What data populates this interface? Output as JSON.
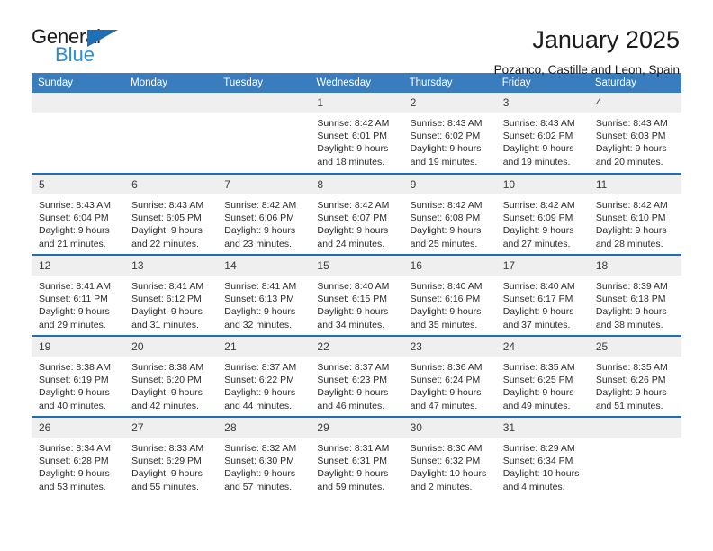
{
  "logo": {
    "word_top": "General",
    "word_bottom": "Blue",
    "triangle_color": "#1f6fb5",
    "blue_color": "#2a8fd8"
  },
  "header": {
    "title": "January 2025",
    "subtitle": "Pozanco, Castille and Leon, Spain",
    "header_bg": "#3a7dbf",
    "row_divider": "#1f6fb5",
    "daynum_bg": "#efefef"
  },
  "weekdays": [
    "Sunday",
    "Monday",
    "Tuesday",
    "Wednesday",
    "Thursday",
    "Friday",
    "Saturday"
  ],
  "weeks": [
    [
      {
        "day": "",
        "lines": []
      },
      {
        "day": "",
        "lines": []
      },
      {
        "day": "",
        "lines": []
      },
      {
        "day": "1",
        "lines": [
          "Sunrise: 8:42 AM",
          "Sunset: 6:01 PM",
          "Daylight: 9 hours",
          "and 18 minutes."
        ]
      },
      {
        "day": "2",
        "lines": [
          "Sunrise: 8:43 AM",
          "Sunset: 6:02 PM",
          "Daylight: 9 hours",
          "and 19 minutes."
        ]
      },
      {
        "day": "3",
        "lines": [
          "Sunrise: 8:43 AM",
          "Sunset: 6:02 PM",
          "Daylight: 9 hours",
          "and 19 minutes."
        ]
      },
      {
        "day": "4",
        "lines": [
          "Sunrise: 8:43 AM",
          "Sunset: 6:03 PM",
          "Daylight: 9 hours",
          "and 20 minutes."
        ]
      }
    ],
    [
      {
        "day": "5",
        "lines": [
          "Sunrise: 8:43 AM",
          "Sunset: 6:04 PM",
          "Daylight: 9 hours",
          "and 21 minutes."
        ]
      },
      {
        "day": "6",
        "lines": [
          "Sunrise: 8:43 AM",
          "Sunset: 6:05 PM",
          "Daylight: 9 hours",
          "and 22 minutes."
        ]
      },
      {
        "day": "7",
        "lines": [
          "Sunrise: 8:42 AM",
          "Sunset: 6:06 PM",
          "Daylight: 9 hours",
          "and 23 minutes."
        ]
      },
      {
        "day": "8",
        "lines": [
          "Sunrise: 8:42 AM",
          "Sunset: 6:07 PM",
          "Daylight: 9 hours",
          "and 24 minutes."
        ]
      },
      {
        "day": "9",
        "lines": [
          "Sunrise: 8:42 AM",
          "Sunset: 6:08 PM",
          "Daylight: 9 hours",
          "and 25 minutes."
        ]
      },
      {
        "day": "10",
        "lines": [
          "Sunrise: 8:42 AM",
          "Sunset: 6:09 PM",
          "Daylight: 9 hours",
          "and 27 minutes."
        ]
      },
      {
        "day": "11",
        "lines": [
          "Sunrise: 8:42 AM",
          "Sunset: 6:10 PM",
          "Daylight: 9 hours",
          "and 28 minutes."
        ]
      }
    ],
    [
      {
        "day": "12",
        "lines": [
          "Sunrise: 8:41 AM",
          "Sunset: 6:11 PM",
          "Daylight: 9 hours",
          "and 29 minutes."
        ]
      },
      {
        "day": "13",
        "lines": [
          "Sunrise: 8:41 AM",
          "Sunset: 6:12 PM",
          "Daylight: 9 hours",
          "and 31 minutes."
        ]
      },
      {
        "day": "14",
        "lines": [
          "Sunrise: 8:41 AM",
          "Sunset: 6:13 PM",
          "Daylight: 9 hours",
          "and 32 minutes."
        ]
      },
      {
        "day": "15",
        "lines": [
          "Sunrise: 8:40 AM",
          "Sunset: 6:15 PM",
          "Daylight: 9 hours",
          "and 34 minutes."
        ]
      },
      {
        "day": "16",
        "lines": [
          "Sunrise: 8:40 AM",
          "Sunset: 6:16 PM",
          "Daylight: 9 hours",
          "and 35 minutes."
        ]
      },
      {
        "day": "17",
        "lines": [
          "Sunrise: 8:40 AM",
          "Sunset: 6:17 PM",
          "Daylight: 9 hours",
          "and 37 minutes."
        ]
      },
      {
        "day": "18",
        "lines": [
          "Sunrise: 8:39 AM",
          "Sunset: 6:18 PM",
          "Daylight: 9 hours",
          "and 38 minutes."
        ]
      }
    ],
    [
      {
        "day": "19",
        "lines": [
          "Sunrise: 8:38 AM",
          "Sunset: 6:19 PM",
          "Daylight: 9 hours",
          "and 40 minutes."
        ]
      },
      {
        "day": "20",
        "lines": [
          "Sunrise: 8:38 AM",
          "Sunset: 6:20 PM",
          "Daylight: 9 hours",
          "and 42 minutes."
        ]
      },
      {
        "day": "21",
        "lines": [
          "Sunrise: 8:37 AM",
          "Sunset: 6:22 PM",
          "Daylight: 9 hours",
          "and 44 minutes."
        ]
      },
      {
        "day": "22",
        "lines": [
          "Sunrise: 8:37 AM",
          "Sunset: 6:23 PM",
          "Daylight: 9 hours",
          "and 46 minutes."
        ]
      },
      {
        "day": "23",
        "lines": [
          "Sunrise: 8:36 AM",
          "Sunset: 6:24 PM",
          "Daylight: 9 hours",
          "and 47 minutes."
        ]
      },
      {
        "day": "24",
        "lines": [
          "Sunrise: 8:35 AM",
          "Sunset: 6:25 PM",
          "Daylight: 9 hours",
          "and 49 minutes."
        ]
      },
      {
        "day": "25",
        "lines": [
          "Sunrise: 8:35 AM",
          "Sunset: 6:26 PM",
          "Daylight: 9 hours",
          "and 51 minutes."
        ]
      }
    ],
    [
      {
        "day": "26",
        "lines": [
          "Sunrise: 8:34 AM",
          "Sunset: 6:28 PM",
          "Daylight: 9 hours",
          "and 53 minutes."
        ]
      },
      {
        "day": "27",
        "lines": [
          "Sunrise: 8:33 AM",
          "Sunset: 6:29 PM",
          "Daylight: 9 hours",
          "and 55 minutes."
        ]
      },
      {
        "day": "28",
        "lines": [
          "Sunrise: 8:32 AM",
          "Sunset: 6:30 PM",
          "Daylight: 9 hours",
          "and 57 minutes."
        ]
      },
      {
        "day": "29",
        "lines": [
          "Sunrise: 8:31 AM",
          "Sunset: 6:31 PM",
          "Daylight: 9 hours",
          "and 59 minutes."
        ]
      },
      {
        "day": "30",
        "lines": [
          "Sunrise: 8:30 AM",
          "Sunset: 6:32 PM",
          "Daylight: 10 hours",
          "and 2 minutes."
        ]
      },
      {
        "day": "31",
        "lines": [
          "Sunrise: 8:29 AM",
          "Sunset: 6:34 PM",
          "Daylight: 10 hours",
          "and 4 minutes."
        ]
      },
      {
        "day": "",
        "lines": []
      }
    ]
  ]
}
